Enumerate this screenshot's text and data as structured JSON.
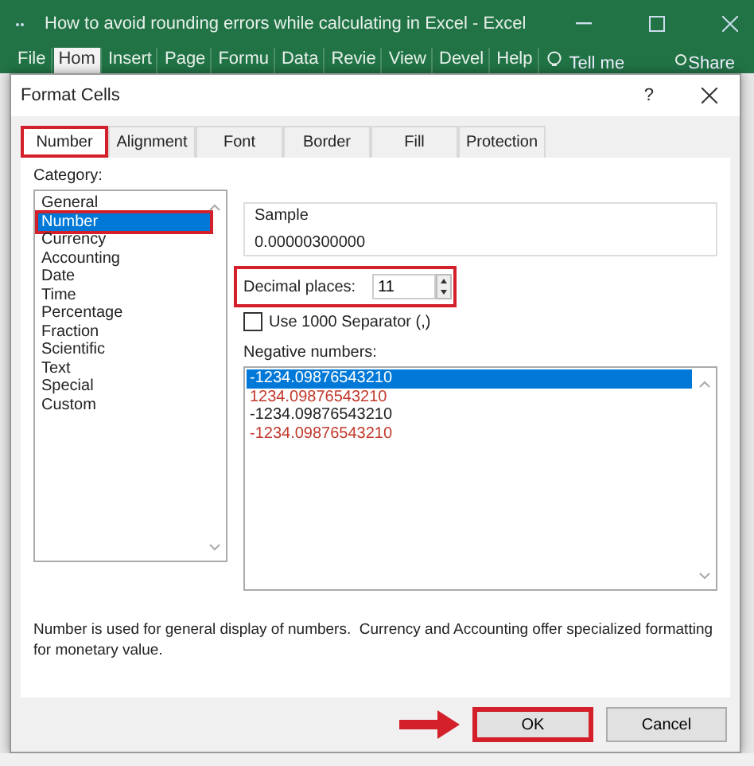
{
  "window": {
    "title": "How to avoid rounding errors while calculating in Excel  -  Excel"
  },
  "ribbon_tabs": [
    {
      "label": "File",
      "selected": false
    },
    {
      "label": "Hom",
      "selected": true
    },
    {
      "label": "Insert",
      "selected": false
    },
    {
      "label": "Page",
      "selected": false
    },
    {
      "label": "Formu",
      "selected": false
    },
    {
      "label": "Data",
      "selected": false
    },
    {
      "label": "Revie",
      "selected": false
    },
    {
      "label": "View",
      "selected": false
    },
    {
      "label": "Devel",
      "selected": false
    },
    {
      "label": "Help",
      "selected": false
    }
  ],
  "tell_me": "Tell me",
  "share": "Share",
  "dialog": {
    "title": "Format Cells",
    "help": "?",
    "tabs": [
      {
        "label": "Number",
        "selected": true,
        "highlighted": true
      },
      {
        "label": "Alignment",
        "selected": false,
        "highlighted": false
      },
      {
        "label": "Font",
        "selected": false,
        "highlighted": false
      },
      {
        "label": "Border",
        "selected": false,
        "highlighted": false
      },
      {
        "label": "Fill",
        "selected": false,
        "highlighted": false
      },
      {
        "label": "Protection",
        "selected": false,
        "highlighted": false
      }
    ],
    "category_label": "Category:",
    "categories": [
      {
        "label": "General",
        "selected": false,
        "highlighted": false
      },
      {
        "label": "Number",
        "selected": true,
        "highlighted": true
      },
      {
        "label": "Currency",
        "selected": false,
        "highlighted": false
      },
      {
        "label": "Accounting",
        "selected": false,
        "highlighted": false
      },
      {
        "label": "Date",
        "selected": false,
        "highlighted": false
      },
      {
        "label": "Time",
        "selected": false,
        "highlighted": false
      },
      {
        "label": "Percentage",
        "selected": false,
        "highlighted": false
      },
      {
        "label": "Fraction",
        "selected": false,
        "highlighted": false
      },
      {
        "label": "Scientific",
        "selected": false,
        "highlighted": false
      },
      {
        "label": "Text",
        "selected": false,
        "highlighted": false
      },
      {
        "label": "Special",
        "selected": false,
        "highlighted": false
      },
      {
        "label": "Custom",
        "selected": false,
        "highlighted": false
      }
    ],
    "sample_label": "Sample",
    "sample_value": "0.00000300000",
    "decimal_places": {
      "label": "Decimal places:",
      "value": "11",
      "highlighted": true
    },
    "separator": {
      "label": "Use 1000 Separator (,)",
      "checked": false
    },
    "negative_label": "Negative numbers:",
    "negative_formats": [
      {
        "text": "-1234.09876543210",
        "red": false,
        "selected": true
      },
      {
        "text": "1234.09876543210",
        "red": true,
        "selected": false
      },
      {
        "text": "-1234.09876543210",
        "red": false,
        "selected": false
      },
      {
        "text": "-1234.09876543210",
        "red": true,
        "selected": false
      }
    ],
    "description": "Number is used for general display of numbers.  Currency and Accounting offer specialized formatting for monetary value.",
    "buttons": [
      {
        "label": "OK",
        "highlighted": true
      },
      {
        "label": "Cancel",
        "highlighted": false
      }
    ]
  }
}
